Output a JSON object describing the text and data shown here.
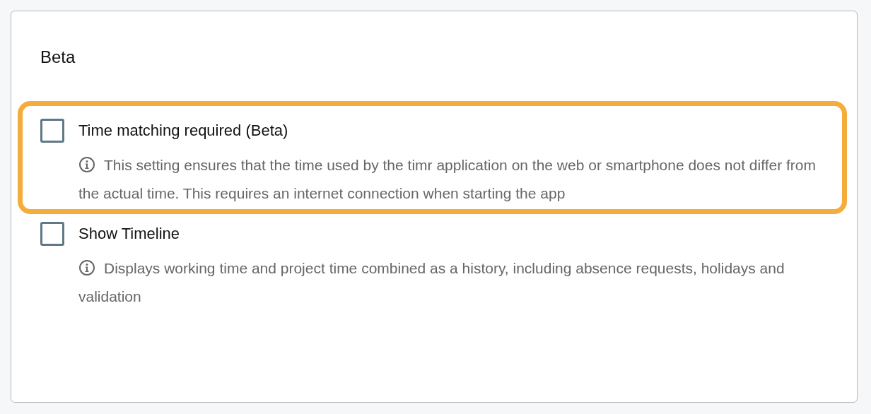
{
  "section": {
    "title": "Beta"
  },
  "options": [
    {
      "label": "Time matching required (Beta)",
      "checked": false,
      "highlighted": true,
      "description": "This setting ensures that the time used by the timr application on the web or smartphone does not differ from the actual time. This requires an internet connection when starting the app"
    },
    {
      "label": "Show Timeline",
      "checked": false,
      "highlighted": false,
      "description": "Displays working time and project time combined as a history, including absence requests, holidays and validation"
    }
  ]
}
